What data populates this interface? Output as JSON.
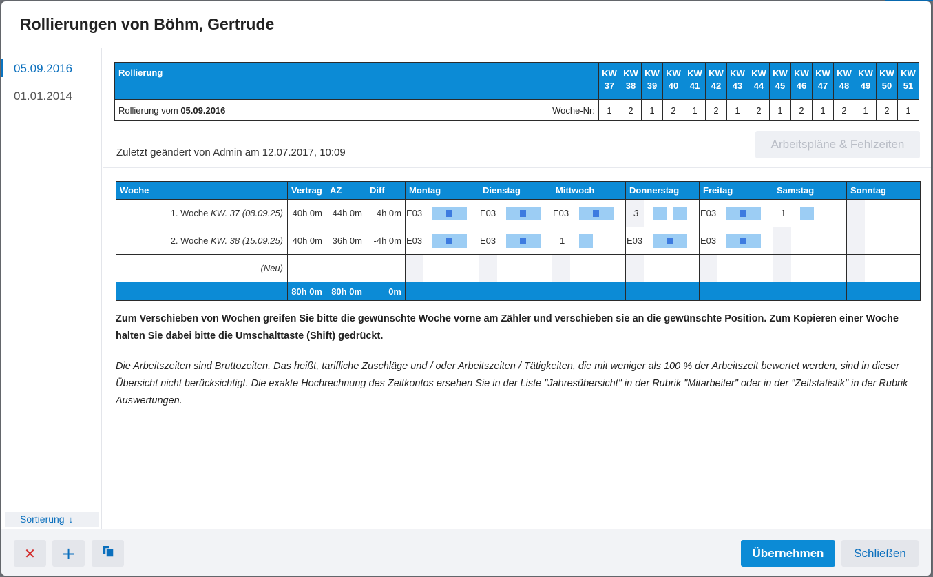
{
  "dialog": {
    "title": "Rollierungen von Böhm, Gertrude"
  },
  "sidebar": {
    "items": [
      {
        "label": "05.09.2016",
        "active": true
      },
      {
        "label": "01.01.2014",
        "active": false
      }
    ],
    "sort_label": "Sortierung",
    "sort_icon": "arrow-down-icon"
  },
  "kw_table": {
    "header_label": "Rollierung",
    "kw_prefix": "KW",
    "weeks": [
      "37",
      "38",
      "39",
      "40",
      "41",
      "42",
      "43",
      "44",
      "45",
      "46",
      "47",
      "48",
      "49",
      "50",
      "51"
    ],
    "row_label_prefix": "Rollierung vom ",
    "row_label_date": "05.09.2016",
    "woche_nr_label": "Woche-Nr:",
    "week_numbers": [
      "1",
      "2",
      "1",
      "2",
      "1",
      "2",
      "1",
      "2",
      "1",
      "2",
      "1",
      "2",
      "1",
      "2",
      "1"
    ]
  },
  "changed_info": "Zuletzt geändert von Admin am 12.07.2017, 10:09",
  "plans_button": "Arbeitspläne & Fehlzeiten",
  "week_table": {
    "headers": {
      "woche": "Woche",
      "vertrag": "Vertrag",
      "az": "AZ",
      "diff": "Diff",
      "mo": "Montag",
      "di": "Dienstag",
      "mi": "Mittwoch",
      "do": "Donnerstag",
      "fr": "Freitag",
      "sa": "Samstag",
      "so": "Sonntag"
    },
    "rows": [
      {
        "label": "1. Woche ",
        "kw": "KW. 37 (08.09.25)",
        "vertrag": "40h 0m",
        "az": "44h 0m",
        "diff": "4h 0m",
        "mo": "E03",
        "di": "E03",
        "mi": "E03",
        "do": "3",
        "fr": "E03",
        "sa": "1",
        "so": ""
      },
      {
        "label": "2. Woche ",
        "kw": "KW. 38 (15.09.25)",
        "vertrag": "40h 0m",
        "az": "36h 0m",
        "diff": "-4h 0m",
        "mo": "E03",
        "di": "E03",
        "mi": "1",
        "do": "E03",
        "fr": "E03",
        "sa": "",
        "so": ""
      }
    ],
    "new_row_label": "(Neu)",
    "footer": {
      "vertrag": "80h 0m",
      "az": "80h 0m",
      "diff": "0m"
    }
  },
  "instructions": "Zum Verschieben von Wochen greifen Sie bitte die gewünschte Woche vorne am Zähler und verschieben sie an die gewünschte Position. Zum Kopieren einer Woche halten Sie dabei bitte die Umschalttaste (Shift) gedrückt.",
  "note": "Die Arbeitszeiten sind Bruttozeiten. Das heißt, tarifliche Zuschläge und / oder Arbeitszeiten / Tätigkeiten, die mit weniger als 100 % der Arbeitszeit bewertet werden, sind in dieser Übersicht nicht berücksichtigt. Die exakte Hochrechnung des Zeitkontos ersehen Sie in der Liste \"Jahresübersicht\" in der Rubrik \"Mitarbeiter\" oder in der \"Zeitstatistik\" in der Rubrik Auswertungen.",
  "footer": {
    "delete_icon": "close-icon",
    "add_icon": "plus-icon",
    "copy_icon": "copy-icon",
    "apply_button": "Übernehmen",
    "close_button": "Schließen"
  },
  "colors": {
    "accent": "#0c8bd6",
    "block": "#9ccdf4",
    "block_dot": "#3d7be0",
    "delete": "#d32f2f"
  }
}
